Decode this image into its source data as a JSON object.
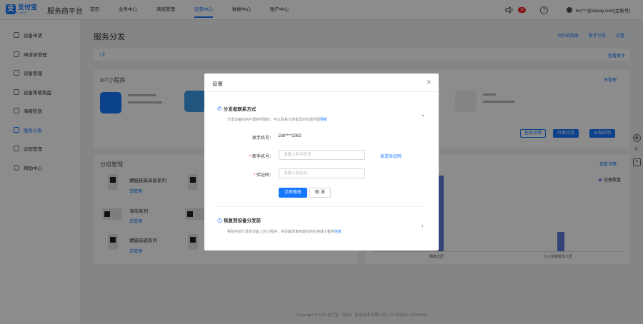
{
  "brand": {
    "logo_mark": "支",
    "logo_text": "支付宝",
    "logo_sub": "ALIPAY",
    "platform": "服务商平台"
  },
  "nav": [
    {
      "label": "首页"
    },
    {
      "label": "业务中心"
    },
    {
      "label": "商家管理"
    },
    {
      "label": "运营中心",
      "active": true
    },
    {
      "label": "数据中心"
    },
    {
      "label": "账户中心"
    }
  ],
  "topbar": {
    "badge": "10",
    "user": "tes***@alipay.com[主账号]"
  },
  "sidebar": [
    {
      "label": "设备申请"
    },
    {
      "label": "申请单管理"
    },
    {
      "label": "设备管理"
    },
    {
      "label": "设备策略看盘"
    },
    {
      "label": "海报投放"
    },
    {
      "label": "服务分发",
      "active": true
    },
    {
      "label": "远程管理"
    },
    {
      "label": "帮助中心"
    }
  ],
  "main": {
    "title": "服务分发",
    "actions": [
      "合作的商家",
      "新手引导",
      "设置"
    ],
    "notice_more": "查看更多",
    "iot_card": {
      "title": "IoT小程序",
      "link": "去管理",
      "buttons": [
        "任务详情",
        "开发应用",
        "分发应用"
      ]
    },
    "group_card": {
      "title": "分组管理",
      "devices": [
        {
          "name": "蜻蜓经典单屏系列",
          "link": "去管理"
        },
        {
          "name": "海鸟系列",
          "link": "去管理"
        },
        {
          "name": "蜻蜓砥砺系列",
          "link": "去管理"
        }
      ]
    },
    "stats_card": {
      "link": "查看详情",
      "legend": "设备数量",
      "x_labels": [
        "蜻蜓云屏",
        "小火苗蜻蜓单大屏"
      ]
    }
  },
  "footer": "Copyright ©2022 支付宝（杭州）信息技术有限公司 | ICP证浙B2-20160559",
  "modal": {
    "title": "设置",
    "section1": {
      "title": "分发者联系方式",
      "desc": "分发设备的用户遇到问题时，可以联系分发者及时处理问题",
      "desc_link": "更新",
      "current_phone_label": "原手机号：",
      "current_phone": "188****2362",
      "new_phone_label": "新手机号：",
      "new_phone_placeholder": "请输入新手机号",
      "send_code": "发送验证码",
      "code_label": "验证码：",
      "code_placeholder": "请输入验证码",
      "submit": "立即修改",
      "cancel": "取 消"
    },
    "section2": {
      "title": "恢复到设备分发前",
      "desc": "移除当前分发到设备上的小程序，将设备恢复到最初的应用或小程序",
      "desc_link": "恢复"
    }
  }
}
